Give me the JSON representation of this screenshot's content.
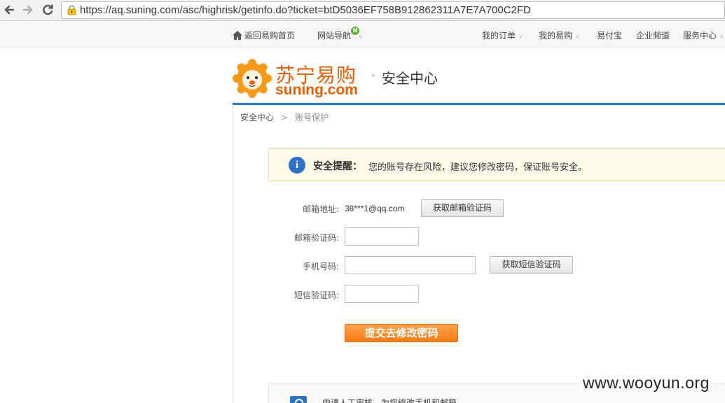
{
  "browser": {
    "url": "https://aq.suning.com/asc/highrisk/getinfo.do?ticket=btD5036EF758B912862311A7E7A700C2FD",
    "back_icon": "arrow-left-icon",
    "forward_icon": "arrow-right-icon",
    "reload_icon": "reload-icon"
  },
  "topbar": {
    "home": "返回易购首页",
    "nav": "网站导航",
    "nav_badge": "N",
    "orders": "我的订单",
    "my_suning": "我的易购",
    "yifubao": "易付宝",
    "enterprise": "企业频道",
    "service": "服务中心"
  },
  "header": {
    "brand_cn": "苏宁易购",
    "brand_en": "suning.com",
    "title": "安全中心"
  },
  "breadcrumb": {
    "root": "安全中心",
    "sep": ">",
    "current": "账号保护"
  },
  "alert": {
    "title": "安全提醒：",
    "message": "您的账号存在风险，建议您修改密码，保证账号安全。",
    "icon": "info-icon"
  },
  "form": {
    "email_label": "邮箱地址:",
    "email_value": "38***1@qq.com",
    "get_email_code": "获取邮箱验证码",
    "email_code_label": "邮箱验证码:",
    "email_code_value": "",
    "phone_label": "手机号码:",
    "phone_value": "",
    "get_sms_code": "获取短信验证码",
    "sms_code_label": "短信验证码:",
    "sms_code_value": "",
    "submit": "提交去修改密码"
  },
  "bottom": {
    "text": "申请人工审核，为您修改手机和邮箱"
  },
  "watermark": "www.wooyun.org",
  "colors": {
    "brand_orange": "#e85f06",
    "accent_blue": "#2b78c5",
    "submit_orange": "#f57b14"
  }
}
